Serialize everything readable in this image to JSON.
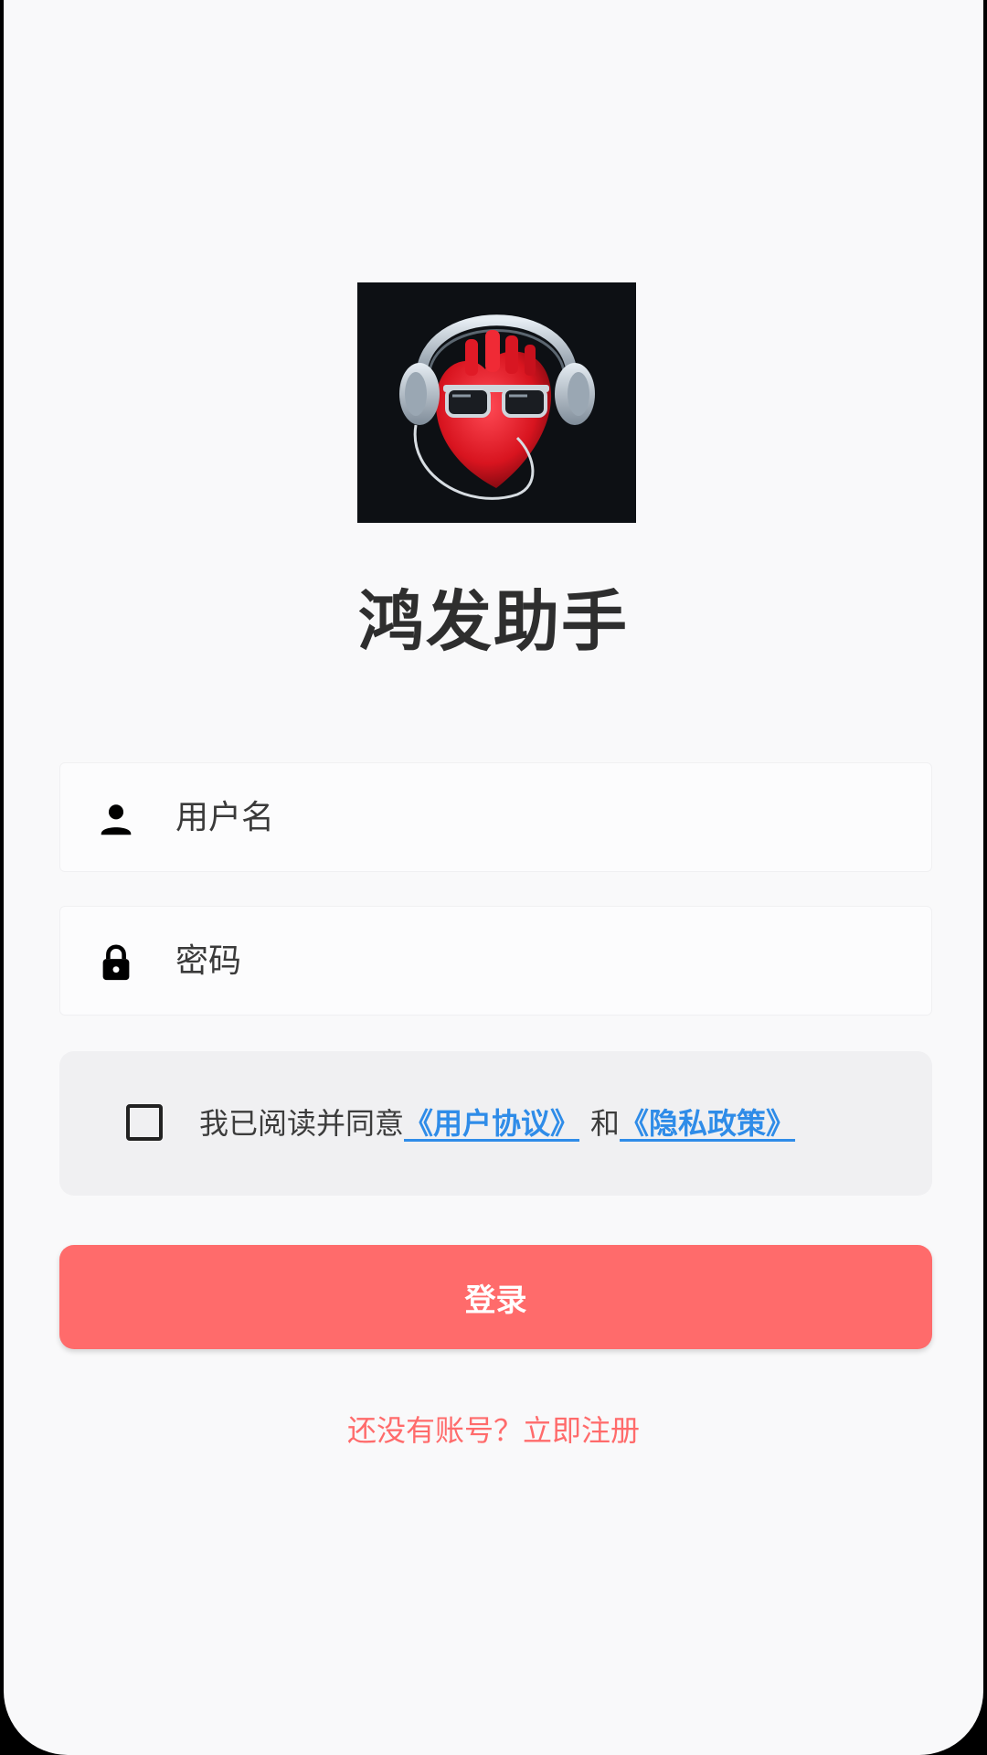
{
  "app": {
    "title": "鸿发助手",
    "logo_icon": "heart-headphones-logo"
  },
  "form": {
    "username_placeholder": "用户名",
    "username_icon": "person-icon",
    "password_placeholder": "密码",
    "password_icon": "lock-icon"
  },
  "agreement": {
    "checked": false,
    "prefix": "我已阅读并同意",
    "user_agreement": "《用户协议》",
    "conjunction": "和",
    "privacy_policy": "《隐私政策》"
  },
  "login_button": "登录",
  "register_link": "还没有账号？立即注册",
  "colors": {
    "accent": "#ff6b6b",
    "link": "#2f8ce8",
    "background": "#f9f9fa"
  }
}
